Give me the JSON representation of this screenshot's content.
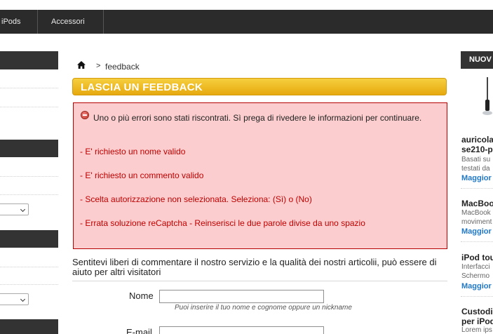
{
  "nav": {
    "items": [
      "iPods",
      "Accessori"
    ]
  },
  "breadcrumb": {
    "separator": ">",
    "current": "feedback"
  },
  "title": "LASCIA UN FEEDBACK",
  "errors": {
    "intro": "Uno o più errori sono stati riscontrati. Sì prega di rivedere le informazioni per continuare.",
    "items": [
      "- E' richiesto un nome valido",
      "- E' richiesto un commento valido",
      "- Scelta autorizzazione non selezionata. Seleziona: (Sì) o (No)",
      "- Errata soluzione reCaptcha - Reinserisci le due parole divise da uno spazio"
    ]
  },
  "intro_text": "Sentitevi liberi di commentare il nostro servizio e la qualità dei nostri articolii, può essere di aiuto per altri visitatori",
  "form": {
    "name_label": "Nome",
    "name_value": "",
    "name_hint": "Puoi inserire il tuo nome e cognome oppure un nickname",
    "email_label": "E-mail",
    "email_value": ""
  },
  "right_sidebar": {
    "heading": "NUOV",
    "products": [
      {
        "title_lines": [
          "auricola",
          "se210-p"
        ],
        "desc_lines": [
          "Basati su",
          "testati da"
        ],
        "more": "Maggior"
      },
      {
        "title_lines": [
          "MacBoo"
        ],
        "desc_lines": [
          "MacBook",
          "moviment"
        ],
        "more": "Maggior"
      },
      {
        "title_lines": [
          "iPod tou"
        ],
        "desc_lines": [
          "Interfacci",
          "Schermo"
        ],
        "more": "Maggior"
      },
      {
        "title_lines": [
          "Custodia",
          "per iPod"
        ],
        "desc_lines": [
          "Lorem ips"
        ],
        "more": ""
      }
    ]
  },
  "colors": {
    "nav_bg": "#2b2b2b",
    "title_gradient_top": "#f6cf3e",
    "title_gradient_bottom": "#e6a90f",
    "error_bg": "#fbcdce",
    "error_border": "#b40000",
    "error_text": "#c00000",
    "link": "#1f78c8"
  }
}
